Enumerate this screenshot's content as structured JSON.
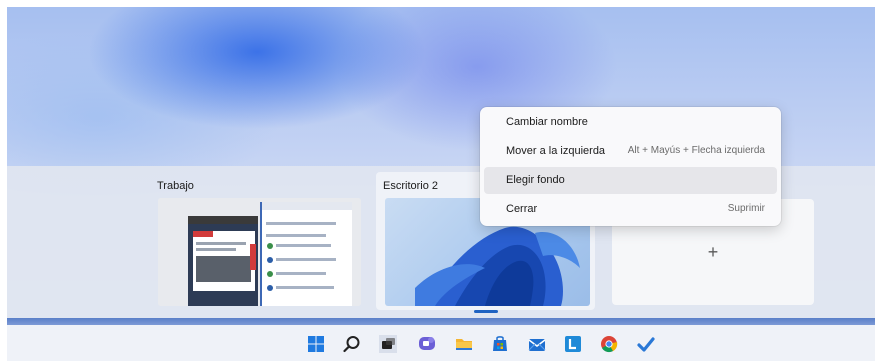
{
  "desktops": [
    {
      "label": "Trabajo"
    },
    {
      "label": "Escritorio 2"
    }
  ],
  "new_desktop": {
    "symbol": "+"
  },
  "context_menu": {
    "items": [
      {
        "label": "Cambiar nombre",
        "shortcut": ""
      },
      {
        "label": "Mover a la izquierda",
        "shortcut": "Alt + Mayús + Flecha izquierda"
      },
      {
        "label": "Elegir fondo",
        "shortcut": ""
      },
      {
        "label": "Cerrar",
        "shortcut": "Suprimir"
      }
    ],
    "highlighted_item": "Elegir fondo"
  },
  "taskbar": {
    "icons": [
      "windows-start-icon",
      "search-icon",
      "task-view-icon",
      "chat-icon",
      "file-explorer-icon",
      "store-icon",
      "mail-icon",
      "lists-app-icon",
      "chrome-icon",
      "todo-check-icon"
    ]
  },
  "colors": {
    "accent": "#1f63c2",
    "taskbar_band": "#5a7fc8",
    "menu_highlight": "#e6e6ea"
  }
}
